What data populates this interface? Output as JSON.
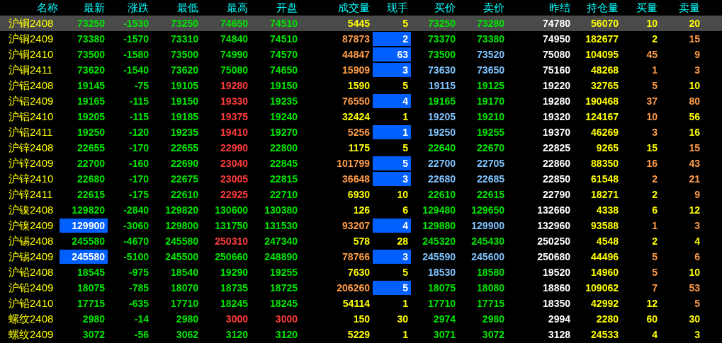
{
  "columns": [
    "名称",
    "最新",
    "涨跌",
    "最低",
    "最高",
    "开盘",
    "成交量",
    "现手",
    "买价",
    "卖价",
    "昨结",
    "持仓量",
    "买量",
    "卖量"
  ],
  "rows": [
    {
      "selected": true,
      "name": "沪铜2408",
      "cells": [
        {
          "text": "73250",
          "color": "#00e600",
          "highlighted": false
        },
        {
          "text": "-1530",
          "color": "#00e600",
          "highlighted": false
        },
        {
          "text": "73250",
          "color": "#00e600",
          "highlighted": false
        },
        {
          "text": "74650",
          "color": "#00e600",
          "highlighted": false
        },
        {
          "text": "74510",
          "color": "#00e600",
          "highlighted": false
        },
        {
          "text": "5445",
          "color": "#ffff00",
          "highlighted": false
        },
        {
          "text": "5",
          "color": "#ffff00",
          "highlighted": false
        },
        {
          "text": "73250",
          "color": "#00e600",
          "highlighted": false
        },
        {
          "text": "73280",
          "color": "#00e600",
          "highlighted": false
        },
        {
          "text": "74780",
          "color": "#ffffff",
          "highlighted": false
        },
        {
          "text": "56070",
          "color": "#ffff00",
          "highlighted": false
        },
        {
          "text": "10",
          "color": "#ffff00",
          "highlighted": false
        },
        {
          "text": "20",
          "color": "#ffff00",
          "highlighted": false
        }
      ]
    },
    {
      "selected": false,
      "name": "沪铜2409",
      "cells": [
        {
          "text": "73380",
          "color": "#00e600",
          "highlighted": false
        },
        {
          "text": "-1570",
          "color": "#00e600",
          "highlighted": false
        },
        {
          "text": "73310",
          "color": "#00e600",
          "highlighted": false
        },
        {
          "text": "74840",
          "color": "#00e600",
          "highlighted": false
        },
        {
          "text": "74510",
          "color": "#00e600",
          "highlighted": false
        },
        {
          "text": "87873",
          "color": "#ff9c4a",
          "highlighted": false
        },
        {
          "text": "2",
          "color": "#ffffff",
          "highlighted": true
        },
        {
          "text": "73370",
          "color": "#00e600",
          "highlighted": false
        },
        {
          "text": "73380",
          "color": "#00e600",
          "highlighted": false
        },
        {
          "text": "74950",
          "color": "#ffffff",
          "highlighted": false
        },
        {
          "text": "182677",
          "color": "#ffff00",
          "highlighted": false
        },
        {
          "text": "2",
          "color": "#ffff00",
          "highlighted": false
        },
        {
          "text": "15",
          "color": "#ff9c4a",
          "highlighted": false
        }
      ]
    },
    {
      "selected": false,
      "name": "沪铜2410",
      "cells": [
        {
          "text": "73500",
          "color": "#00e600",
          "highlighted": false
        },
        {
          "text": "-1580",
          "color": "#00e600",
          "highlighted": false
        },
        {
          "text": "73500",
          "color": "#00e600",
          "highlighted": false
        },
        {
          "text": "74990",
          "color": "#00e600",
          "highlighted": false
        },
        {
          "text": "74570",
          "color": "#00e600",
          "highlighted": false
        },
        {
          "text": "44847",
          "color": "#ff9c4a",
          "highlighted": false
        },
        {
          "text": "63",
          "color": "#ffffff",
          "highlighted": true
        },
        {
          "text": "73500",
          "color": "#00e600",
          "highlighted": false
        },
        {
          "text": "73520",
          "color": "#80c4ff",
          "highlighted": false
        },
        {
          "text": "75080",
          "color": "#ffffff",
          "highlighted": false
        },
        {
          "text": "104095",
          "color": "#ffff00",
          "highlighted": false
        },
        {
          "text": "45",
          "color": "#ff9c4a",
          "highlighted": false
        },
        {
          "text": "9",
          "color": "#ff9c4a",
          "highlighted": false
        }
      ]
    },
    {
      "selected": false,
      "name": "沪铜2411",
      "cells": [
        {
          "text": "73620",
          "color": "#00e600",
          "highlighted": false
        },
        {
          "text": "-1540",
          "color": "#00e600",
          "highlighted": false
        },
        {
          "text": "73620",
          "color": "#00e600",
          "highlighted": false
        },
        {
          "text": "75080",
          "color": "#00e600",
          "highlighted": false
        },
        {
          "text": "74650",
          "color": "#00e600",
          "highlighted": false
        },
        {
          "text": "15909",
          "color": "#ff9c4a",
          "highlighted": false
        },
        {
          "text": "3",
          "color": "#ffffff",
          "highlighted": true
        },
        {
          "text": "73630",
          "color": "#80c4ff",
          "highlighted": false
        },
        {
          "text": "73650",
          "color": "#80c4ff",
          "highlighted": false
        },
        {
          "text": "75160",
          "color": "#ffffff",
          "highlighted": false
        },
        {
          "text": "48268",
          "color": "#ffff00",
          "highlighted": false
        },
        {
          "text": "1",
          "color": "#ff9c4a",
          "highlighted": false
        },
        {
          "text": "3",
          "color": "#ff9c4a",
          "highlighted": false
        }
      ]
    },
    {
      "selected": false,
      "name": "沪铝2408",
      "cells": [
        {
          "text": "19145",
          "color": "#00e600",
          "highlighted": false
        },
        {
          "text": "-75",
          "color": "#00e600",
          "highlighted": false
        },
        {
          "text": "19105",
          "color": "#00e600",
          "highlighted": false
        },
        {
          "text": "19280",
          "color": "#ff3c3c",
          "highlighted": false
        },
        {
          "text": "19150",
          "color": "#00e600",
          "highlighted": false
        },
        {
          "text": "1590",
          "color": "#ffff00",
          "highlighted": false
        },
        {
          "text": "5",
          "color": "#ffff00",
          "highlighted": false
        },
        {
          "text": "19115",
          "color": "#80c4ff",
          "highlighted": false
        },
        {
          "text": "19125",
          "color": "#00e600",
          "highlighted": false
        },
        {
          "text": "19220",
          "color": "#ffffff",
          "highlighted": false
        },
        {
          "text": "32765",
          "color": "#ffff00",
          "highlighted": false
        },
        {
          "text": "5",
          "color": "#ff9c4a",
          "highlighted": false
        },
        {
          "text": "10",
          "color": "#ffff00",
          "highlighted": false
        }
      ]
    },
    {
      "selected": false,
      "name": "沪铝2409",
      "cells": [
        {
          "text": "19165",
          "color": "#00e600",
          "highlighted": false
        },
        {
          "text": "-115",
          "color": "#00e600",
          "highlighted": false
        },
        {
          "text": "19150",
          "color": "#00e600",
          "highlighted": false
        },
        {
          "text": "19330",
          "color": "#ff3c3c",
          "highlighted": false
        },
        {
          "text": "19235",
          "color": "#00e600",
          "highlighted": false
        },
        {
          "text": "76550",
          "color": "#ff9c4a",
          "highlighted": false
        },
        {
          "text": "4",
          "color": "#ffffff",
          "highlighted": true
        },
        {
          "text": "19165",
          "color": "#00e600",
          "highlighted": false
        },
        {
          "text": "19170",
          "color": "#00e600",
          "highlighted": false
        },
        {
          "text": "19280",
          "color": "#ffffff",
          "highlighted": false
        },
        {
          "text": "190468",
          "color": "#ffff00",
          "highlighted": false
        },
        {
          "text": "37",
          "color": "#ff9c4a",
          "highlighted": false
        },
        {
          "text": "80",
          "color": "#ff9c4a",
          "highlighted": false
        }
      ]
    },
    {
      "selected": false,
      "name": "沪铝2410",
      "cells": [
        {
          "text": "19205",
          "color": "#00e600",
          "highlighted": false
        },
        {
          "text": "-115",
          "color": "#00e600",
          "highlighted": false
        },
        {
          "text": "19185",
          "color": "#00e600",
          "highlighted": false
        },
        {
          "text": "19375",
          "color": "#ff3c3c",
          "highlighted": false
        },
        {
          "text": "19240",
          "color": "#00e600",
          "highlighted": false
        },
        {
          "text": "32424",
          "color": "#ffff00",
          "highlighted": false
        },
        {
          "text": "1",
          "color": "#ffff00",
          "highlighted": false
        },
        {
          "text": "19205",
          "color": "#80c4ff",
          "highlighted": false
        },
        {
          "text": "19210",
          "color": "#00e600",
          "highlighted": false
        },
        {
          "text": "19320",
          "color": "#ffffff",
          "highlighted": false
        },
        {
          "text": "124167",
          "color": "#ffff00",
          "highlighted": false
        },
        {
          "text": "10",
          "color": "#ff9c4a",
          "highlighted": false
        },
        {
          "text": "56",
          "color": "#ffff00",
          "highlighted": false
        }
      ]
    },
    {
      "selected": false,
      "name": "沪铝2411",
      "cells": [
        {
          "text": "19250",
          "color": "#00e600",
          "highlighted": false
        },
        {
          "text": "-120",
          "color": "#00e600",
          "highlighted": false
        },
        {
          "text": "19235",
          "color": "#00e600",
          "highlighted": false
        },
        {
          "text": "19410",
          "color": "#ff3c3c",
          "highlighted": false
        },
        {
          "text": "19270",
          "color": "#00e600",
          "highlighted": false
        },
        {
          "text": "5256",
          "color": "#ff9c4a",
          "highlighted": false
        },
        {
          "text": "1",
          "color": "#ffffff",
          "highlighted": true
        },
        {
          "text": "19250",
          "color": "#80c4ff",
          "highlighted": false
        },
        {
          "text": "19255",
          "color": "#00e600",
          "highlighted": false
        },
        {
          "text": "19370",
          "color": "#ffffff",
          "highlighted": false
        },
        {
          "text": "46269",
          "color": "#ffff00",
          "highlighted": false
        },
        {
          "text": "3",
          "color": "#ff9c4a",
          "highlighted": false
        },
        {
          "text": "16",
          "color": "#ffff00",
          "highlighted": false
        }
      ]
    },
    {
      "selected": false,
      "name": "沪锌2408",
      "cells": [
        {
          "text": "22655",
          "color": "#00e600",
          "highlighted": false
        },
        {
          "text": "-170",
          "color": "#00e600",
          "highlighted": false
        },
        {
          "text": "22655",
          "color": "#00e600",
          "highlighted": false
        },
        {
          "text": "22990",
          "color": "#ff3c3c",
          "highlighted": false
        },
        {
          "text": "22800",
          "color": "#00e600",
          "highlighted": false
        },
        {
          "text": "1175",
          "color": "#ffff00",
          "highlighted": false
        },
        {
          "text": "5",
          "color": "#ffff00",
          "highlighted": false
        },
        {
          "text": "22640",
          "color": "#00e600",
          "highlighted": false
        },
        {
          "text": "22670",
          "color": "#00e600",
          "highlighted": false
        },
        {
          "text": "22825",
          "color": "#ffffff",
          "highlighted": false
        },
        {
          "text": "9265",
          "color": "#ffff00",
          "highlighted": false
        },
        {
          "text": "15",
          "color": "#ffff00",
          "highlighted": false
        },
        {
          "text": "15",
          "color": "#ff9c4a",
          "highlighted": false
        }
      ]
    },
    {
      "selected": false,
      "name": "沪锌2409",
      "cells": [
        {
          "text": "22700",
          "color": "#00e600",
          "highlighted": false
        },
        {
          "text": "-160",
          "color": "#00e600",
          "highlighted": false
        },
        {
          "text": "22690",
          "color": "#00e600",
          "highlighted": false
        },
        {
          "text": "23040",
          "color": "#ff3c3c",
          "highlighted": false
        },
        {
          "text": "22845",
          "color": "#00e600",
          "highlighted": false
        },
        {
          "text": "101799",
          "color": "#ff9c4a",
          "highlighted": false
        },
        {
          "text": "5",
          "color": "#ffffff",
          "highlighted": true
        },
        {
          "text": "22700",
          "color": "#80c4ff",
          "highlighted": false
        },
        {
          "text": "22705",
          "color": "#80c4ff",
          "highlighted": false
        },
        {
          "text": "22860",
          "color": "#ffffff",
          "highlighted": false
        },
        {
          "text": "88350",
          "color": "#ffff00",
          "highlighted": false
        },
        {
          "text": "16",
          "color": "#ff9c4a",
          "highlighted": false
        },
        {
          "text": "43",
          "color": "#ff9c4a",
          "highlighted": false
        }
      ]
    },
    {
      "selected": false,
      "name": "沪锌2410",
      "cells": [
        {
          "text": "22680",
          "color": "#00e600",
          "highlighted": false
        },
        {
          "text": "-170",
          "color": "#00e600",
          "highlighted": false
        },
        {
          "text": "22675",
          "color": "#00e600",
          "highlighted": false
        },
        {
          "text": "23005",
          "color": "#ff3c3c",
          "highlighted": false
        },
        {
          "text": "22815",
          "color": "#00e600",
          "highlighted": false
        },
        {
          "text": "36648",
          "color": "#ff9c4a",
          "highlighted": false
        },
        {
          "text": "3",
          "color": "#ffffff",
          "highlighted": true
        },
        {
          "text": "22680",
          "color": "#80c4ff",
          "highlighted": false
        },
        {
          "text": "22685",
          "color": "#80c4ff",
          "highlighted": false
        },
        {
          "text": "22850",
          "color": "#ffffff",
          "highlighted": false
        },
        {
          "text": "61548",
          "color": "#ffff00",
          "highlighted": false
        },
        {
          "text": "2",
          "color": "#ff9c4a",
          "highlighted": false
        },
        {
          "text": "21",
          "color": "#ff9c4a",
          "highlighted": false
        }
      ]
    },
    {
      "selected": false,
      "name": "沪锌2411",
      "cells": [
        {
          "text": "22615",
          "color": "#00e600",
          "highlighted": false
        },
        {
          "text": "-175",
          "color": "#00e600",
          "highlighted": false
        },
        {
          "text": "22610",
          "color": "#00e600",
          "highlighted": false
        },
        {
          "text": "22925",
          "color": "#ff3c3c",
          "highlighted": false
        },
        {
          "text": "22710",
          "color": "#00e600",
          "highlighted": false
        },
        {
          "text": "6930",
          "color": "#ffff00",
          "highlighted": false
        },
        {
          "text": "10",
          "color": "#ffff00",
          "highlighted": false
        },
        {
          "text": "22610",
          "color": "#00e600",
          "highlighted": false
        },
        {
          "text": "22615",
          "color": "#00e600",
          "highlighted": false
        },
        {
          "text": "22790",
          "color": "#ffffff",
          "highlighted": false
        },
        {
          "text": "18271",
          "color": "#ffff00",
          "highlighted": false
        },
        {
          "text": "2",
          "color": "#ffff00",
          "highlighted": false
        },
        {
          "text": "9",
          "color": "#ff9c4a",
          "highlighted": false
        }
      ]
    },
    {
      "selected": false,
      "name": "沪镍2408",
      "cells": [
        {
          "text": "129820",
          "color": "#00e600",
          "highlighted": false
        },
        {
          "text": "-2840",
          "color": "#00e600",
          "highlighted": false
        },
        {
          "text": "129820",
          "color": "#00e600",
          "highlighted": false
        },
        {
          "text": "130600",
          "color": "#00e600",
          "highlighted": false
        },
        {
          "text": "130380",
          "color": "#00e600",
          "highlighted": false
        },
        {
          "text": "126",
          "color": "#ffff00",
          "highlighted": false
        },
        {
          "text": "6",
          "color": "#ffff00",
          "highlighted": false
        },
        {
          "text": "129480",
          "color": "#00e600",
          "highlighted": false
        },
        {
          "text": "129650",
          "color": "#00e600",
          "highlighted": false
        },
        {
          "text": "132660",
          "color": "#ffffff",
          "highlighted": false
        },
        {
          "text": "4338",
          "color": "#ffff00",
          "highlighted": false
        },
        {
          "text": "6",
          "color": "#ffff00",
          "highlighted": false
        },
        {
          "text": "12",
          "color": "#ffff00",
          "highlighted": false
        }
      ]
    },
    {
      "selected": false,
      "name": "沪镍2409",
      "cells": [
        {
          "text": "129900",
          "color": "#ffffff",
          "highlighted": true
        },
        {
          "text": "-3060",
          "color": "#00e600",
          "highlighted": false
        },
        {
          "text": "129800",
          "color": "#00e600",
          "highlighted": false
        },
        {
          "text": "131750",
          "color": "#00e600",
          "highlighted": false
        },
        {
          "text": "131530",
          "color": "#00e600",
          "highlighted": false
        },
        {
          "text": "93207",
          "color": "#ff9c4a",
          "highlighted": false
        },
        {
          "text": "4",
          "color": "#ffffff",
          "highlighted": true
        },
        {
          "text": "129880",
          "color": "#00e600",
          "highlighted": false
        },
        {
          "text": "129900",
          "color": "#80c4ff",
          "highlighted": false
        },
        {
          "text": "132960",
          "color": "#ffffff",
          "highlighted": false
        },
        {
          "text": "93588",
          "color": "#ffff00",
          "highlighted": false
        },
        {
          "text": "1",
          "color": "#ff9c4a",
          "highlighted": false
        },
        {
          "text": "3",
          "color": "#ff9c4a",
          "highlighted": false
        }
      ]
    },
    {
      "selected": false,
      "name": "沪锡2408",
      "cells": [
        {
          "text": "245580",
          "color": "#00e600",
          "highlighted": false
        },
        {
          "text": "-4670",
          "color": "#00e600",
          "highlighted": false
        },
        {
          "text": "245580",
          "color": "#00e600",
          "highlighted": false
        },
        {
          "text": "250310",
          "color": "#ff3c3c",
          "highlighted": false
        },
        {
          "text": "247340",
          "color": "#00e600",
          "highlighted": false
        },
        {
          "text": "578",
          "color": "#ffff00",
          "highlighted": false
        },
        {
          "text": "28",
          "color": "#ffff00",
          "highlighted": false
        },
        {
          "text": "245320",
          "color": "#00e600",
          "highlighted": false
        },
        {
          "text": "245430",
          "color": "#00e600",
          "highlighted": false
        },
        {
          "text": "250250",
          "color": "#ffffff",
          "highlighted": false
        },
        {
          "text": "4548",
          "color": "#ffff00",
          "highlighted": false
        },
        {
          "text": "2",
          "color": "#ffff00",
          "highlighted": false
        },
        {
          "text": "4",
          "color": "#ffff00",
          "highlighted": false
        }
      ]
    },
    {
      "selected": false,
      "name": "沪锡2409",
      "cells": [
        {
          "text": "245580",
          "color": "#ffffff",
          "highlighted": true
        },
        {
          "text": "-5100",
          "color": "#00e600",
          "highlighted": false
        },
        {
          "text": "245500",
          "color": "#00e600",
          "highlighted": false
        },
        {
          "text": "250660",
          "color": "#00e600",
          "highlighted": false
        },
        {
          "text": "248890",
          "color": "#00e600",
          "highlighted": false
        },
        {
          "text": "78766",
          "color": "#ff9c4a",
          "highlighted": false
        },
        {
          "text": "3",
          "color": "#ffffff",
          "highlighted": true
        },
        {
          "text": "245590",
          "color": "#80c4ff",
          "highlighted": false
        },
        {
          "text": "245600",
          "color": "#80c4ff",
          "highlighted": false
        },
        {
          "text": "250680",
          "color": "#ffffff",
          "highlighted": false
        },
        {
          "text": "44496",
          "color": "#ffff00",
          "highlighted": false
        },
        {
          "text": "5",
          "color": "#ff9c4a",
          "highlighted": false
        },
        {
          "text": "6",
          "color": "#ff9c4a",
          "highlighted": false
        }
      ]
    },
    {
      "selected": false,
      "name": "沪铅2408",
      "cells": [
        {
          "text": "18545",
          "color": "#00e600",
          "highlighted": false
        },
        {
          "text": "-975",
          "color": "#00e600",
          "highlighted": false
        },
        {
          "text": "18540",
          "color": "#00e600",
          "highlighted": false
        },
        {
          "text": "19290",
          "color": "#00e600",
          "highlighted": false
        },
        {
          "text": "19255",
          "color": "#00e600",
          "highlighted": false
        },
        {
          "text": "7630",
          "color": "#ffff00",
          "highlighted": false
        },
        {
          "text": "5",
          "color": "#ffff00",
          "highlighted": false
        },
        {
          "text": "18530",
          "color": "#80c4ff",
          "highlighted": false
        },
        {
          "text": "18580",
          "color": "#00e600",
          "highlighted": false
        },
        {
          "text": "19520",
          "color": "#ffffff",
          "highlighted": false
        },
        {
          "text": "14960",
          "color": "#ffff00",
          "highlighted": false
        },
        {
          "text": "5",
          "color": "#ff9c4a",
          "highlighted": false
        },
        {
          "text": "10",
          "color": "#ffff00",
          "highlighted": false
        }
      ]
    },
    {
      "selected": false,
      "name": "沪铅2409",
      "cells": [
        {
          "text": "18075",
          "color": "#00e600",
          "highlighted": false
        },
        {
          "text": "-785",
          "color": "#00e600",
          "highlighted": false
        },
        {
          "text": "18070",
          "color": "#00e600",
          "highlighted": false
        },
        {
          "text": "18735",
          "color": "#00e600",
          "highlighted": false
        },
        {
          "text": "18725",
          "color": "#00e600",
          "highlighted": false
        },
        {
          "text": "206260",
          "color": "#ff9c4a",
          "highlighted": false
        },
        {
          "text": "5",
          "color": "#ffffff",
          "highlighted": true
        },
        {
          "text": "18075",
          "color": "#00e600",
          "highlighted": false
        },
        {
          "text": "18080",
          "color": "#00e600",
          "highlighted": false
        },
        {
          "text": "18860",
          "color": "#ffffff",
          "highlighted": false
        },
        {
          "text": "109062",
          "color": "#ffff00",
          "highlighted": false
        },
        {
          "text": "7",
          "color": "#ff9c4a",
          "highlighted": false
        },
        {
          "text": "53",
          "color": "#ff9c4a",
          "highlighted": false
        }
      ]
    },
    {
      "selected": false,
      "name": "沪铅2410",
      "cells": [
        {
          "text": "17715",
          "color": "#00e600",
          "highlighted": false
        },
        {
          "text": "-635",
          "color": "#00e600",
          "highlighted": false
        },
        {
          "text": "17710",
          "color": "#00e600",
          "highlighted": false
        },
        {
          "text": "18245",
          "color": "#00e600",
          "highlighted": false
        },
        {
          "text": "18245",
          "color": "#00e600",
          "highlighted": false
        },
        {
          "text": "54114",
          "color": "#ffff00",
          "highlighted": false
        },
        {
          "text": "1",
          "color": "#ffff00",
          "highlighted": false
        },
        {
          "text": "17710",
          "color": "#00e600",
          "highlighted": false
        },
        {
          "text": "17715",
          "color": "#00e600",
          "highlighted": false
        },
        {
          "text": "18350",
          "color": "#ffffff",
          "highlighted": false
        },
        {
          "text": "42992",
          "color": "#ffff00",
          "highlighted": false
        },
        {
          "text": "12",
          "color": "#ffff00",
          "highlighted": false
        },
        {
          "text": "5",
          "color": "#ff9c4a",
          "highlighted": false
        }
      ]
    },
    {
      "selected": false,
      "name": "螺纹2408",
      "cells": [
        {
          "text": "2980",
          "color": "#00e600",
          "highlighted": false
        },
        {
          "text": "-14",
          "color": "#00e600",
          "highlighted": false
        },
        {
          "text": "2980",
          "color": "#00e600",
          "highlighted": false
        },
        {
          "text": "3000",
          "color": "#ff3c3c",
          "highlighted": false
        },
        {
          "text": "3000",
          "color": "#ff3c3c",
          "highlighted": false
        },
        {
          "text": "150",
          "color": "#ffff00",
          "highlighted": false
        },
        {
          "text": "30",
          "color": "#ffff00",
          "highlighted": false
        },
        {
          "text": "2974",
          "color": "#00e600",
          "highlighted": false
        },
        {
          "text": "2980",
          "color": "#00e600",
          "highlighted": false
        },
        {
          "text": "2994",
          "color": "#ffffff",
          "highlighted": false
        },
        {
          "text": "2280",
          "color": "#ffff00",
          "highlighted": false
        },
        {
          "text": "60",
          "color": "#ffff00",
          "highlighted": false
        },
        {
          "text": "30",
          "color": "#ffff00",
          "highlighted": false
        }
      ]
    },
    {
      "selected": false,
      "name": "螺纹2409",
      "cells": [
        {
          "text": "3072",
          "color": "#00e600",
          "highlighted": false
        },
        {
          "text": "-56",
          "color": "#00e600",
          "highlighted": false
        },
        {
          "text": "3062",
          "color": "#00e600",
          "highlighted": false
        },
        {
          "text": "3120",
          "color": "#00e600",
          "highlighted": false
        },
        {
          "text": "3120",
          "color": "#00e600",
          "highlighted": false
        },
        {
          "text": "5229",
          "color": "#ffff00",
          "highlighted": false
        },
        {
          "text": "1",
          "color": "#ffff00",
          "highlighted": false
        },
        {
          "text": "3071",
          "color": "#00e600",
          "highlighted": false
        },
        {
          "text": "3072",
          "color": "#00e600",
          "highlighted": false
        },
        {
          "text": "3128",
          "color": "#ffffff",
          "highlighted": false
        },
        {
          "text": "24533",
          "color": "#ffff00",
          "highlighted": false
        },
        {
          "text": "4",
          "color": "#ffff00",
          "highlighted": false
        },
        {
          "text": "3",
          "color": "#ffff00",
          "highlighted": false
        }
      ]
    }
  ]
}
